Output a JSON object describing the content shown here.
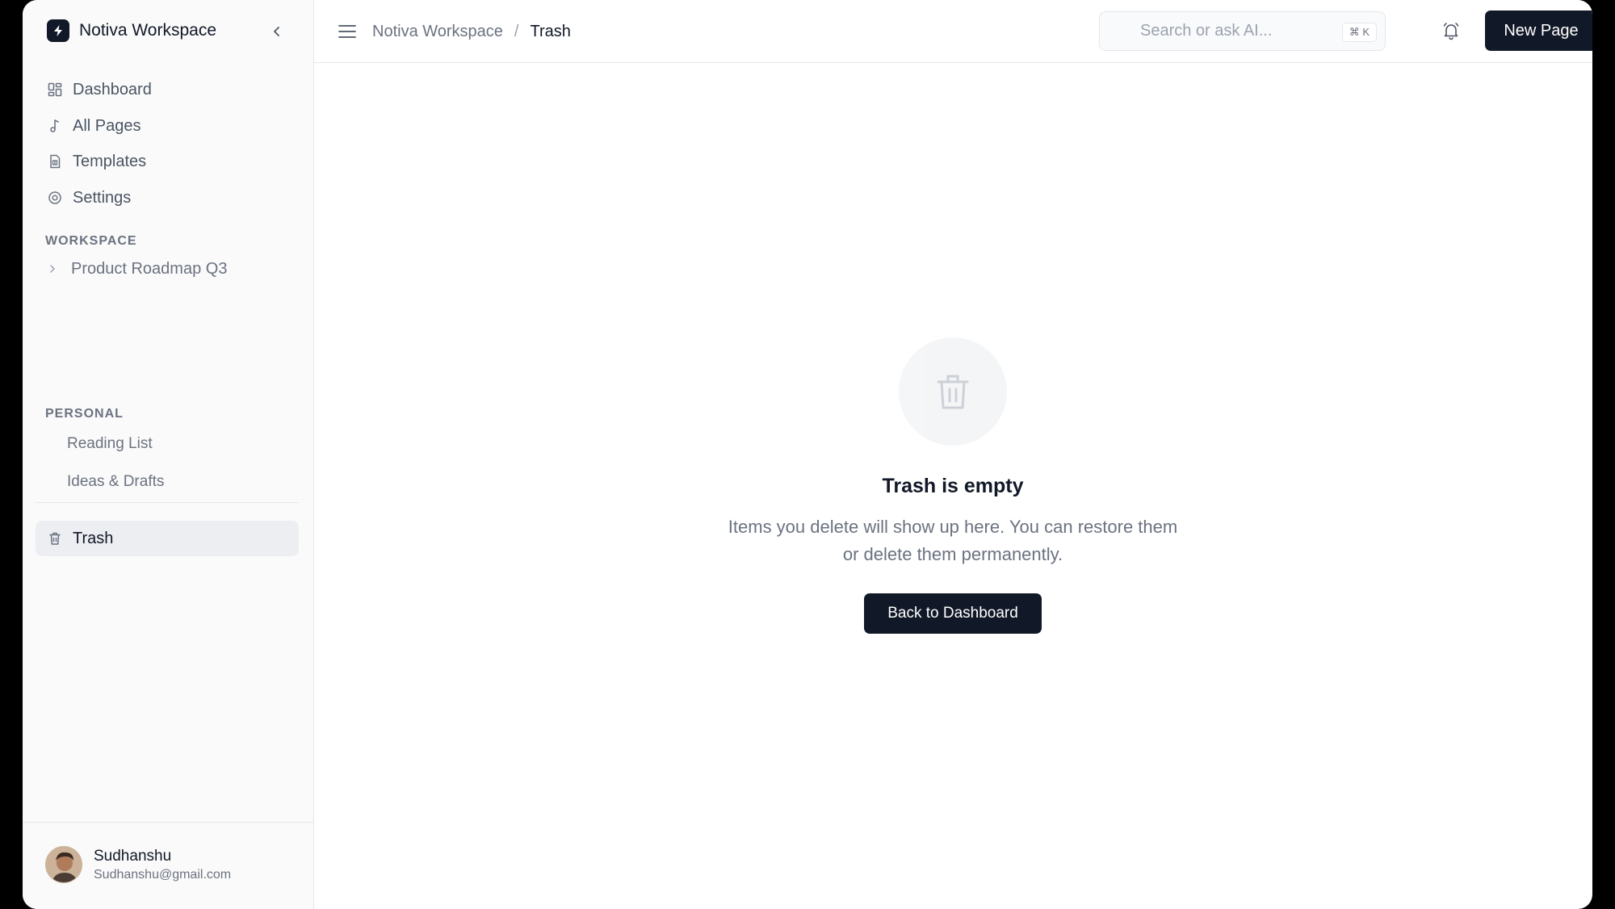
{
  "app": {
    "name": "Notiva Workspace"
  },
  "sidebar": {
    "nav": [
      {
        "label": "Dashboard",
        "icon": "dashboard-icon"
      },
      {
        "label": "All Pages",
        "icon": "pages-icon"
      },
      {
        "label": "Templates",
        "icon": "template-icon"
      },
      {
        "label": "Settings",
        "icon": "gear-icon"
      }
    ],
    "workspace_title": "WORKSPACE",
    "workspace_items": [
      {
        "label": "Product Roadmap Q3"
      }
    ],
    "personal_title": "PERSONAL",
    "personal_items": [
      {
        "label": "Reading List"
      },
      {
        "label": "Ideas & Drafts"
      }
    ],
    "trash_label": "Trash"
  },
  "user": {
    "name": "Sudhanshu",
    "email": "Sudhanshu@gmail.com"
  },
  "header": {
    "breadcrumb_parent": "Notiva Workspace",
    "breadcrumb_sep": "/",
    "breadcrumb_current": "Trash",
    "search_placeholder": "Search or ask AI...",
    "search_shortcut": "⌘ K",
    "new_page_label": "New Page"
  },
  "empty_state": {
    "title": "Trash is empty",
    "description": "Items you delete will show up here. You can restore them or delete them permanently.",
    "button_label": "Back to Dashboard"
  },
  "colors": {
    "primary": "#111827",
    "sidebar_bg": "#fafafa",
    "active_bg": "#eceef1",
    "muted": "#6b7280"
  }
}
